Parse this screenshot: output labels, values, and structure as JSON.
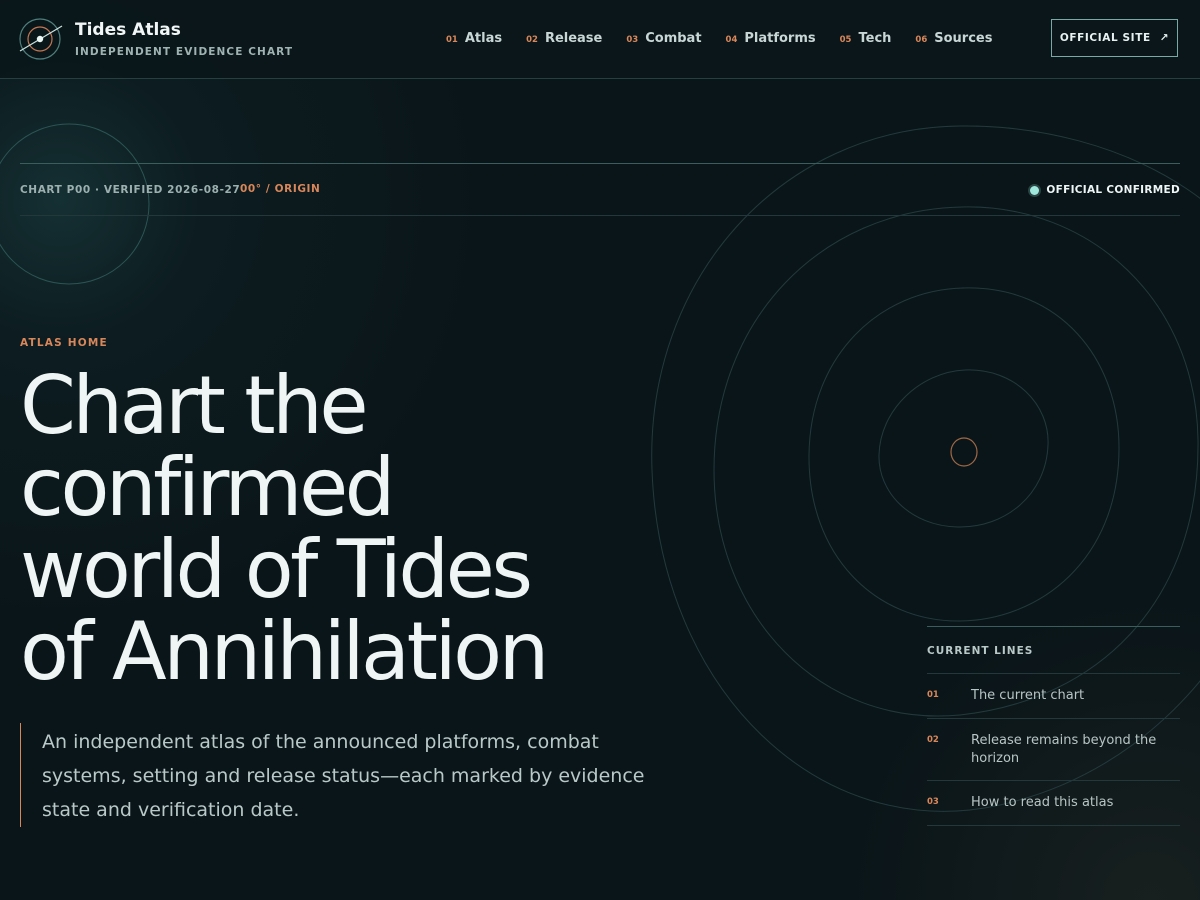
{
  "brand": {
    "name": "Tides Atlas",
    "tagline": "INDEPENDENT EVIDENCE CHART",
    "logo_icon": "compass-orbit-icon"
  },
  "nav": [
    {
      "num": "01",
      "label": "Atlas"
    },
    {
      "num": "02",
      "label": "Release"
    },
    {
      "num": "03",
      "label": "Combat"
    },
    {
      "num": "04",
      "label": "Platforms"
    },
    {
      "num": "05",
      "label": "Tech"
    },
    {
      "num": "06",
      "label": "Sources"
    }
  ],
  "official_site": {
    "label": "OFFICIAL SITE",
    "icon": "arrow-up-right-icon",
    "glyph": "↗"
  },
  "meta": {
    "chart": "CHART P00 · VERIFIED 2026-08-27",
    "origin": "00° / ORIGIN",
    "status": "OFFICIAL CONFIRMED"
  },
  "hero": {
    "eyebrow": "ATLAS HOME",
    "headline_lines": [
      "Chart the",
      "confirmed",
      "world of Tides",
      "of Annihilation"
    ],
    "lede": "An independent atlas of the announced platforms, combat systems, setting and release status—each marked by evidence state and verification date."
  },
  "current_lines": {
    "heading": "CURRENT LINES",
    "items": [
      {
        "num": "01",
        "text": "The current chart"
      },
      {
        "num": "02",
        "text": "Release remains beyond the horizon"
      },
      {
        "num": "03",
        "text": "How to read this atlas"
      }
    ]
  },
  "colors": {
    "background": "#0a1519",
    "accent": "#d9875a",
    "status_dot": "#9fe6dc",
    "rule": "#3a5e5c"
  }
}
